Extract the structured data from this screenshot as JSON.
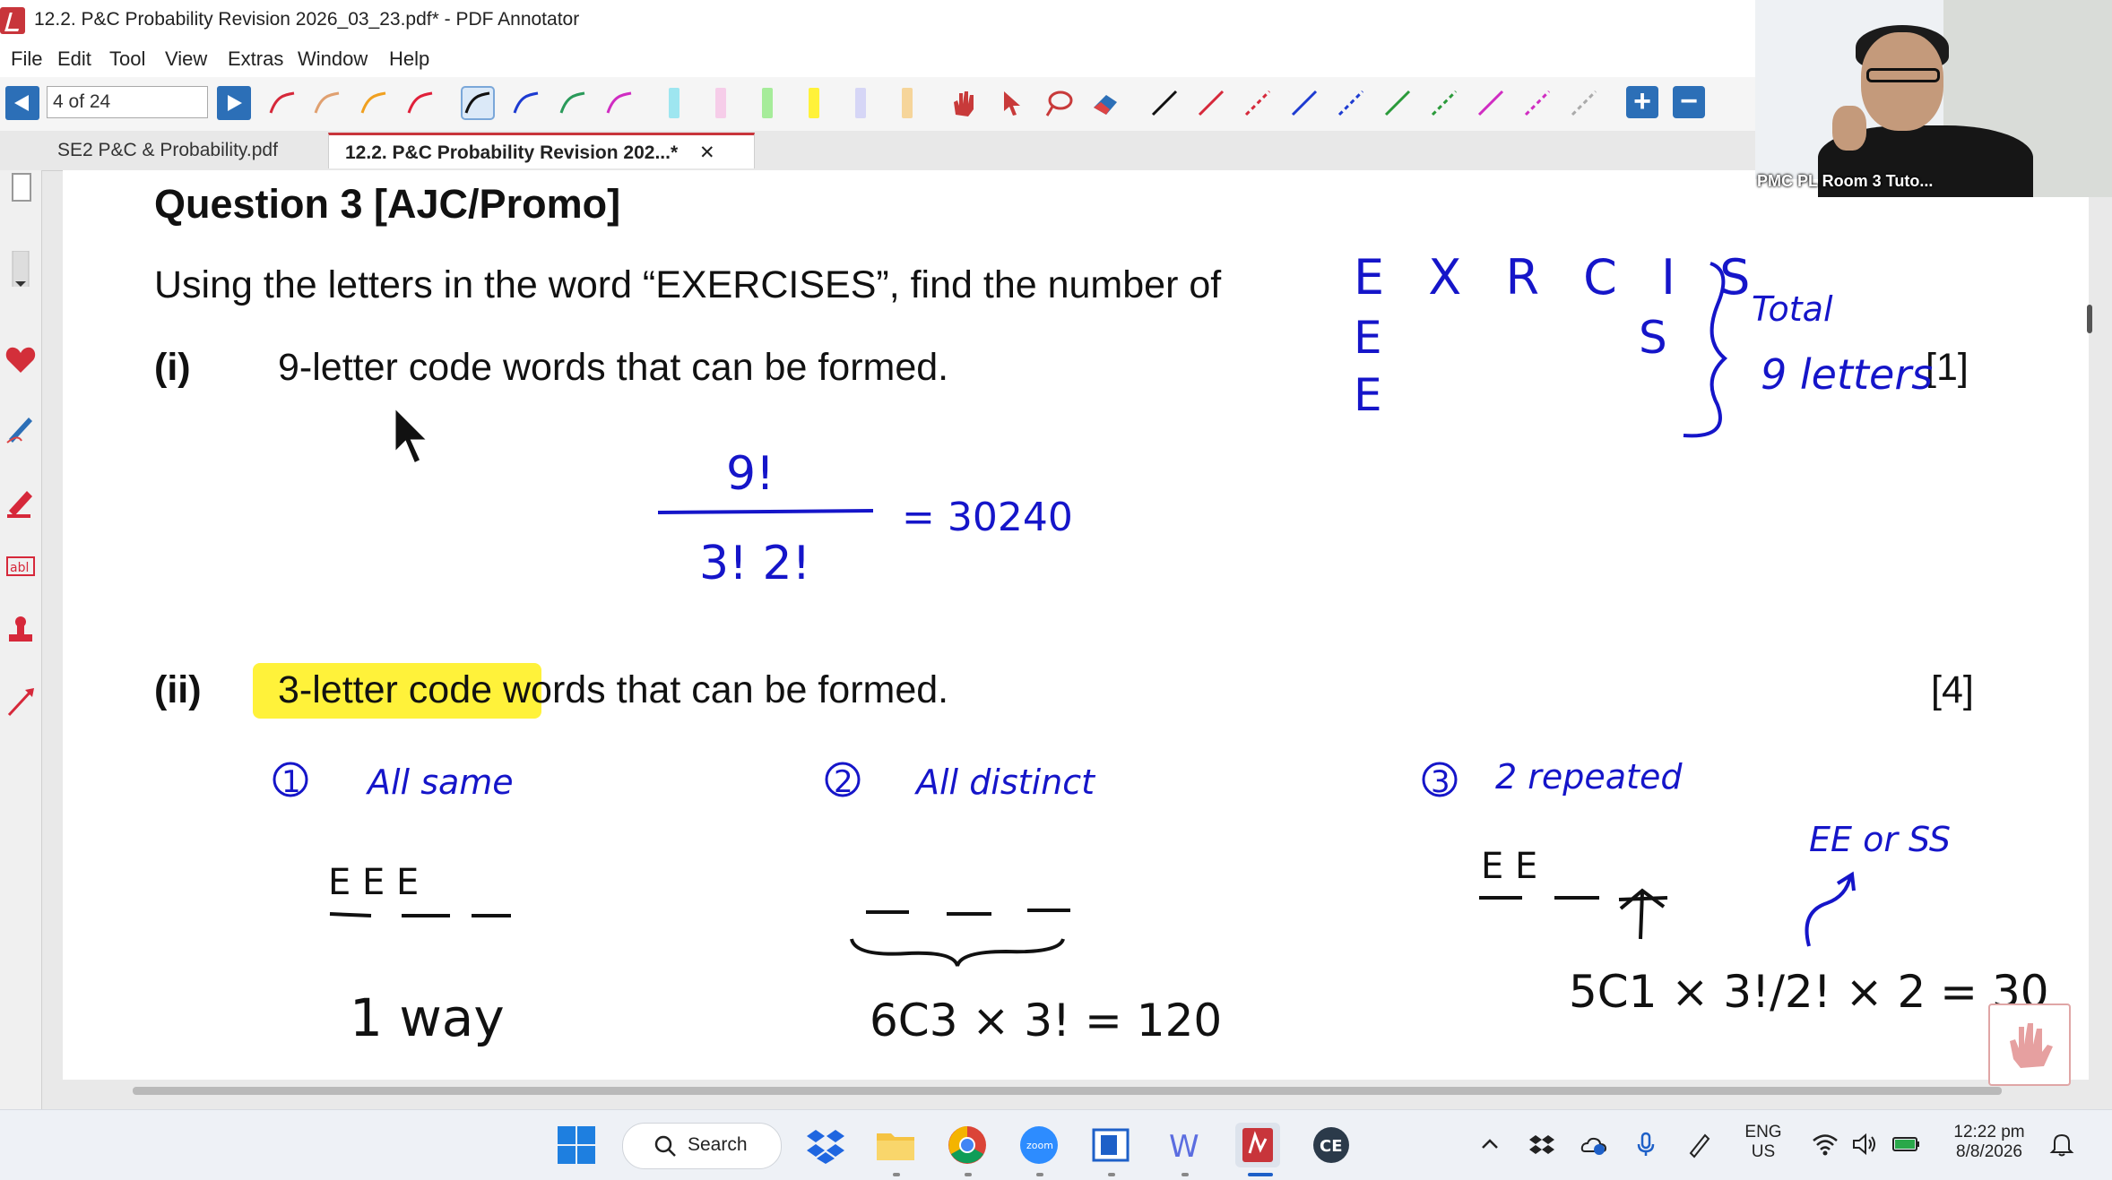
{
  "window": {
    "title": "12.2. P&C Probability Revision 2026_03_23.pdf* - PDF Annotator"
  },
  "menu": [
    "File",
    "Edit",
    "Tool",
    "View",
    "Extras",
    "Window",
    "Help"
  ],
  "toolbar": {
    "page_indicator": "4 of 24"
  },
  "tabs": [
    {
      "label": "SE2 P&C & Probability.pdf",
      "active": false
    },
    {
      "label": "12.2. P&C Probability Revision 202...*",
      "active": true,
      "close": "✕"
    }
  ],
  "document": {
    "heading": "Question 3 [AJC/Promo]",
    "intro": "Using the letters in the word “EXERCISES”, find the number of",
    "part_i_label": "(i)",
    "part_i_text": "9-letter code words that can be formed.",
    "part_i_marks": "[1]",
    "part_ii_label": "(ii)",
    "part_ii_text_highlighted": "3-letter code w",
    "part_ii_text_rest": "ords that can be formed.",
    "part_ii_marks": "[4]",
    "highlight_color": "#fff23a"
  },
  "annotations": {
    "ink_color": "#1515c9",
    "letter_grid_row1": "E X R C I S",
    "letter_grid_row2_e": "E",
    "letter_grid_row2_s": "S",
    "letter_grid_row3_e": "E",
    "total_label": "Total",
    "total_value": "9 letters",
    "part_i_numerator": "9!",
    "part_i_denominator": "3! 2!",
    "part_i_result": "= 30240",
    "case1_num": "1",
    "case1_label": "All same",
    "case1_letters": "E  E  E",
    "case1_result": "1 way",
    "case2_num": "2",
    "case2_label": "All distinct",
    "case2_result": "6C3 × 3! = 120",
    "case3_num": "3",
    "case3_label": "2 repeated",
    "case3_letters": "E  E",
    "case3_note": "EE or SS",
    "case3_result": "5C1 × 3!/2! × 2 = 30"
  },
  "video": {
    "label": "PMC PL Room 3 Tuto..."
  },
  "taskbar": {
    "search_label": "Search",
    "lang_line1": "ENG",
    "lang_line2": "US",
    "time": "12:22 pm",
    "date": "8/8/2026"
  }
}
